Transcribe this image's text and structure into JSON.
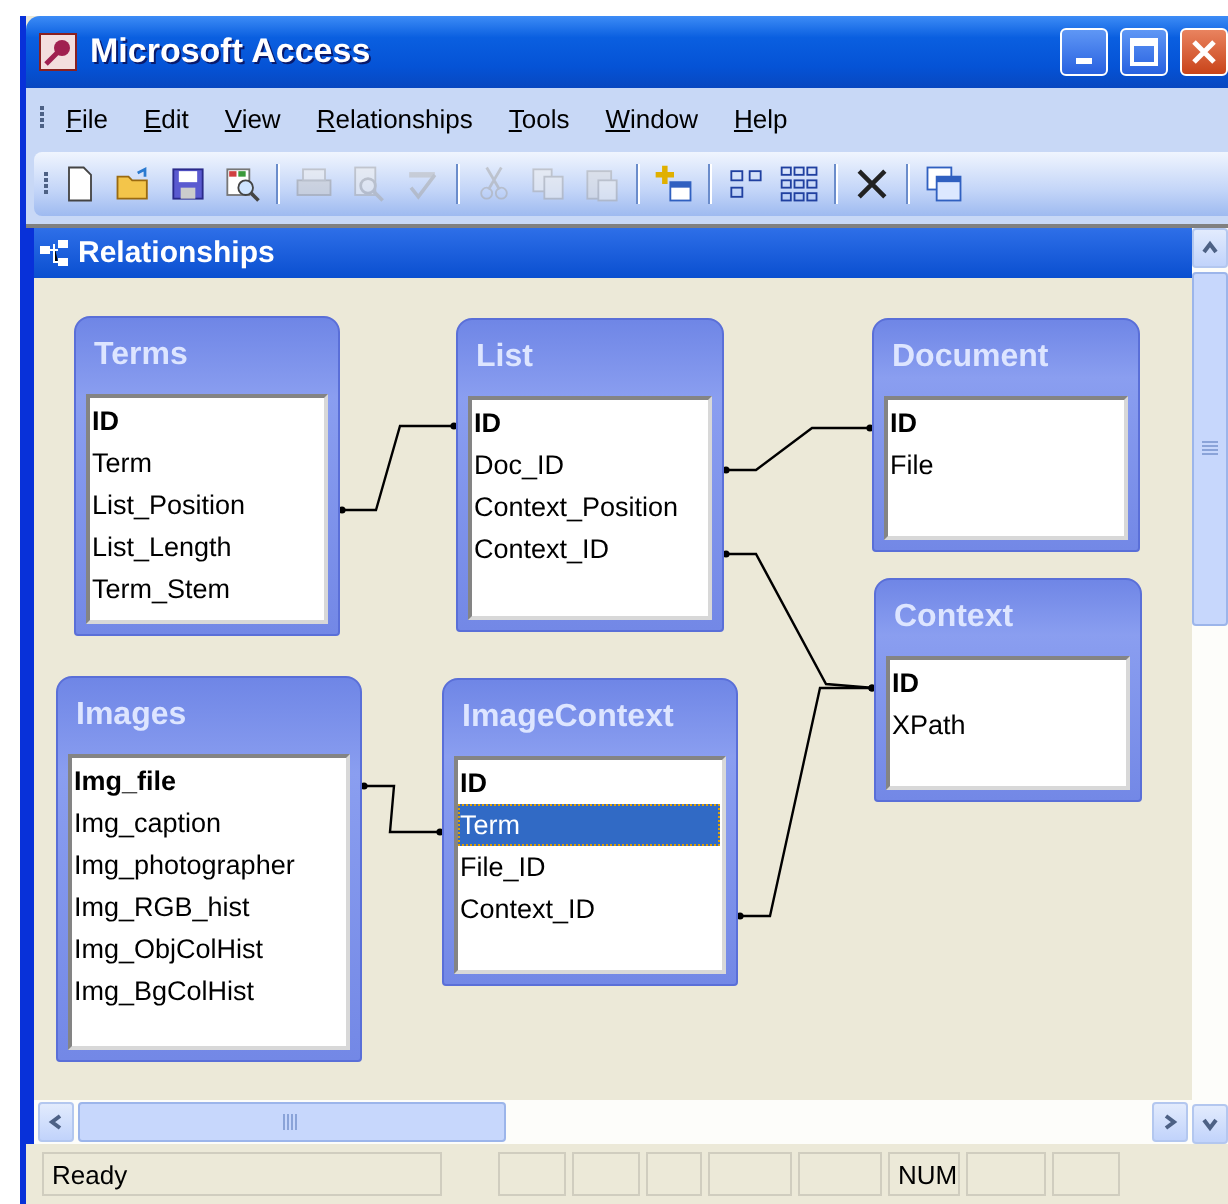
{
  "window": {
    "title": "Microsoft Access"
  },
  "menu": [
    {
      "label": "File"
    },
    {
      "label": "Edit"
    },
    {
      "label": "View"
    },
    {
      "label": "Relationships"
    },
    {
      "label": "Tools"
    },
    {
      "label": "Window"
    },
    {
      "label": "Help"
    }
  ],
  "toolbar": [
    {
      "kind": "new",
      "disabled": false
    },
    {
      "kind": "open",
      "disabled": false
    },
    {
      "kind": "save",
      "disabled": false
    },
    {
      "kind": "search",
      "disabled": false
    },
    {
      "kind": "sep"
    },
    {
      "kind": "print",
      "disabled": true
    },
    {
      "kind": "preview",
      "disabled": true
    },
    {
      "kind": "spell",
      "disabled": true
    },
    {
      "kind": "sep"
    },
    {
      "kind": "cut",
      "disabled": true
    },
    {
      "kind": "copy",
      "disabled": true
    },
    {
      "kind": "paste",
      "disabled": true
    },
    {
      "kind": "sep"
    },
    {
      "kind": "addtable",
      "disabled": false
    },
    {
      "kind": "sep"
    },
    {
      "kind": "direct",
      "disabled": false
    },
    {
      "kind": "all",
      "disabled": false
    },
    {
      "kind": "sep"
    },
    {
      "kind": "delete",
      "disabled": false
    },
    {
      "kind": "sep"
    },
    {
      "kind": "window",
      "disabled": false
    }
  ],
  "document": {
    "title": "Relationships"
  },
  "tables": [
    {
      "title": "Terms",
      "fields": [
        {
          "name": "ID",
          "key": true,
          "selected": false
        },
        {
          "name": "Term",
          "key": false,
          "selected": false
        },
        {
          "name": "List_Position",
          "key": false,
          "selected": false
        },
        {
          "name": "List_Length",
          "key": false,
          "selected": false
        },
        {
          "name": "Term_Stem",
          "key": false,
          "selected": false
        }
      ]
    },
    {
      "title": "List",
      "fields": [
        {
          "name": "ID",
          "key": true,
          "selected": false
        },
        {
          "name": "Doc_ID",
          "key": false,
          "selected": false
        },
        {
          "name": "Context_Position",
          "key": false,
          "selected": false
        },
        {
          "name": "Context_ID",
          "key": false,
          "selected": false
        }
      ]
    },
    {
      "title": "Document",
      "fields": [
        {
          "name": "ID",
          "key": true,
          "selected": false
        },
        {
          "name": "File",
          "key": false,
          "selected": false
        }
      ]
    },
    {
      "title": "Context",
      "fields": [
        {
          "name": "ID",
          "key": true,
          "selected": false
        },
        {
          "name": "XPath",
          "key": false,
          "selected": false
        }
      ]
    },
    {
      "title": "Images",
      "fields": [
        {
          "name": "Img_file",
          "key": true,
          "selected": false
        },
        {
          "name": "Img_caption",
          "key": false,
          "selected": false
        },
        {
          "name": "Img_photographer",
          "key": false,
          "selected": false
        },
        {
          "name": "Img_RGB_hist",
          "key": false,
          "selected": false
        },
        {
          "name": "Img_ObjColHist",
          "key": false,
          "selected": false
        },
        {
          "name": "Img_BgColHist",
          "key": false,
          "selected": false
        }
      ]
    },
    {
      "title": "ImageContext",
      "fields": [
        {
          "name": "ID",
          "key": true,
          "selected": false
        },
        {
          "name": "Term",
          "key": false,
          "selected": true
        },
        {
          "name": "File_ID",
          "key": false,
          "selected": false
        },
        {
          "name": "Context_ID",
          "key": false,
          "selected": false
        }
      ]
    }
  ],
  "status_bar": {
    "text": "Ready",
    "num_lock": "NUM"
  }
}
